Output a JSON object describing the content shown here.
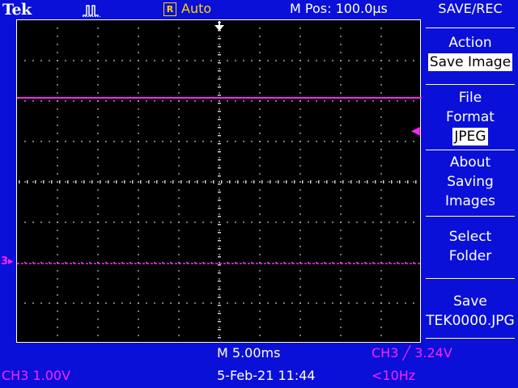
{
  "brand": "Tek",
  "acquisition_icon": "run-pulse-icon",
  "trigger": {
    "badge": "R",
    "mode": "Auto"
  },
  "horizontal_position": "M Pos: 100.0µs",
  "menu": {
    "title": "SAVE/REC",
    "items": [
      {
        "label_lines": [
          "Action"
        ],
        "value": "Save Image"
      },
      {
        "label_lines": [
          "File",
          "Format"
        ],
        "value": "JPEG"
      },
      {
        "label_lines": [
          "About",
          "Saving",
          "Images"
        ]
      },
      {
        "label_lines": [
          "Select",
          "Folder"
        ]
      },
      {
        "label_lines": [
          "Save",
          "TEK0000.JPG"
        ]
      }
    ]
  },
  "channel_marker": "3",
  "status": {
    "timebase": "M 5.00ms",
    "trigger_readout": "CH3 ╱ 3.24V",
    "channel_scale": "CH3  1.00V",
    "datetime": "5-Feb-21 11:44",
    "frequency": "<10Hz"
  },
  "colors": {
    "background": "#0a10d8",
    "graticule_bg": "#000000",
    "ch3": "#ff22ff",
    "trigger": "#ffd400",
    "text": "#ffffff"
  }
}
